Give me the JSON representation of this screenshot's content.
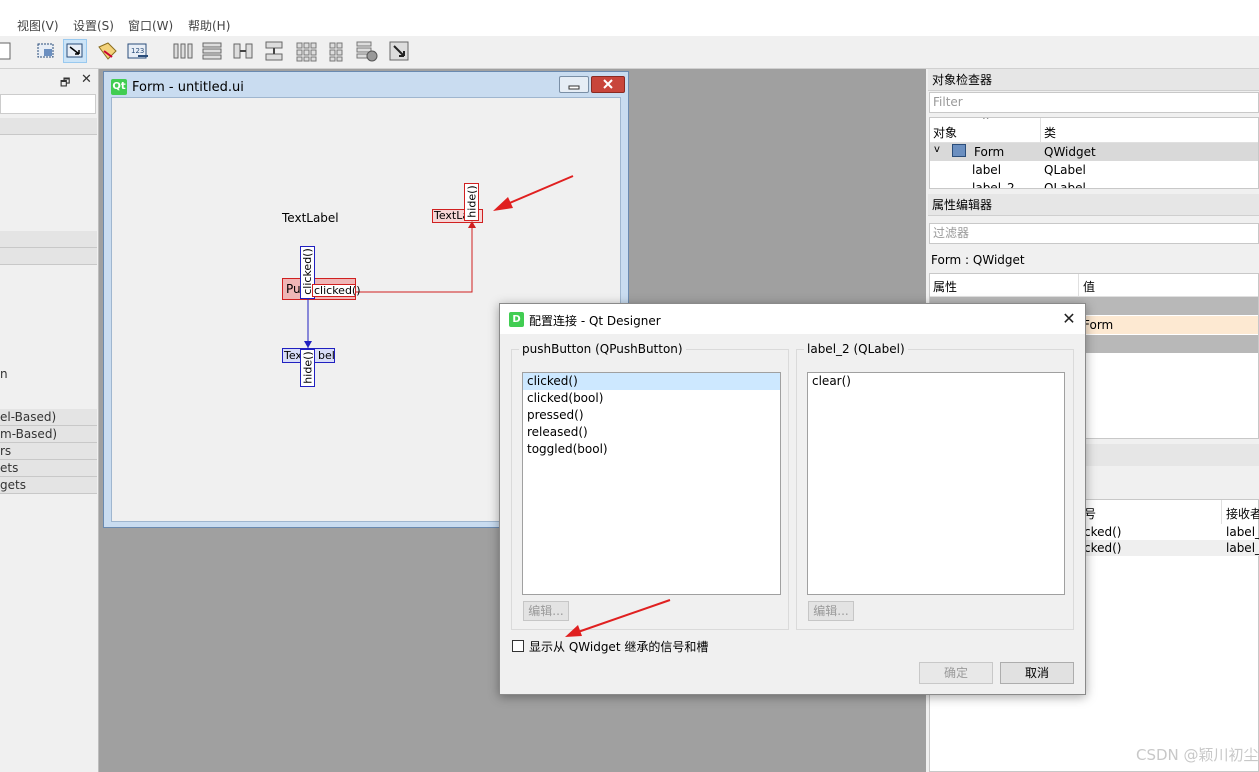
{
  "menu": {
    "view": "视图(V)",
    "settings": "设置(S)",
    "window": "窗口(W)",
    "help": "帮助(H)"
  },
  "left_dock": {
    "groups": [
      "el-Based)",
      "m-Based)",
      "rs",
      "ets",
      "gets"
    ],
    "stray": "n"
  },
  "form": {
    "title": "Form - untitled.ui",
    "qt_logo": "Qt",
    "label1": "TextLabel",
    "label2_text": "TextLa",
    "pushbutton_text": "Pu",
    "label3_a": "Tex",
    "label3_b": "bel",
    "conn1_signal": "clicked()",
    "conn1_slot": "hide()",
    "conn2_signal": "clicked()",
    "conn2_slot": "hide()"
  },
  "object_inspector": {
    "title": "对象检查器",
    "filter_placeholder": "Filter",
    "col_object": "对象",
    "col_class": "类",
    "rows": [
      {
        "object": "Form",
        "class": "QWidget"
      },
      {
        "object": "label",
        "class": "QLabel"
      },
      {
        "object": "label_2",
        "class": "QLabel"
      }
    ]
  },
  "property_editor": {
    "title": "属性编辑器",
    "filter_placeholder": "过滤器",
    "context": "Form : QWidget",
    "col_property": "属性",
    "col_value": "值",
    "value_row": "Form"
  },
  "signal_slot_editor": {
    "col_signal": "号",
    "col_receiver": "接收者",
    "rows": [
      {
        "signal": "cked()",
        "receiver": "label_"
      },
      {
        "signal": "cked()",
        "receiver": "label_"
      }
    ]
  },
  "dialog": {
    "title": "配置连接 - Qt Designer",
    "logo": "D",
    "left_group": "pushButton (QPushButton)",
    "right_group": "label_2 (QLabel)",
    "signals": [
      "clicked()",
      "clicked(bool)",
      "pressed()",
      "released()",
      "toggled(bool)"
    ],
    "selected_signal_index": 0,
    "slots": [
      "clear()"
    ],
    "edit_left": "编辑...",
    "edit_right": "编辑...",
    "checkbox_label": "显示从 QWidget 继承的信号和槽",
    "checkbox_checked": false,
    "ok": "确定",
    "cancel": "取消",
    "close_icon": "close-icon"
  },
  "watermark": "CSDN @颖川初尘"
}
